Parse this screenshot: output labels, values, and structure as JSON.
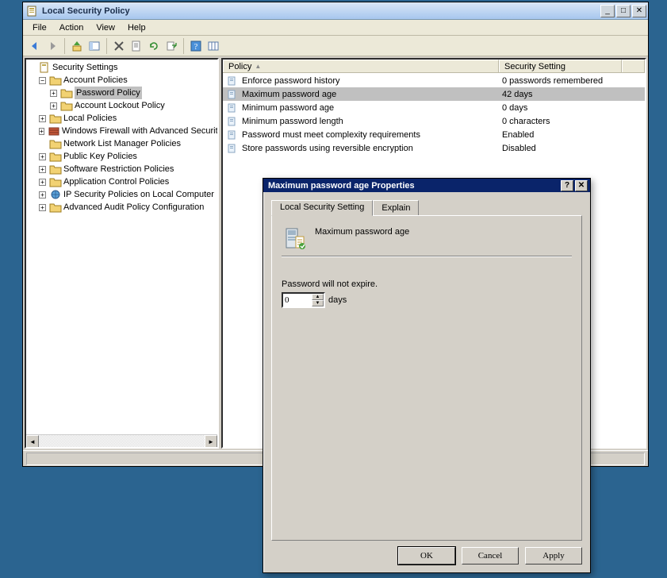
{
  "window": {
    "title": "Local Security Policy",
    "controls": {
      "minimize": "_",
      "maximize": "□",
      "close": "✕"
    }
  },
  "menu": {
    "items": [
      "File",
      "Action",
      "View",
      "Help"
    ]
  },
  "toolbar": {
    "icons": [
      "back",
      "forward",
      "up",
      "detail",
      "delete",
      "refresh",
      "export",
      "help",
      "columns"
    ]
  },
  "tree": {
    "root": "Security Settings",
    "account_policies": "Account Policies",
    "password_policy": "Password Policy",
    "account_lockout_policy": "Account Lockout Policy",
    "local_policies": "Local Policies",
    "windows_firewall": "Windows Firewall with Advanced Security",
    "network_list": "Network List Manager Policies",
    "public_key": "Public Key Policies",
    "software_restriction": "Software Restriction Policies",
    "app_control": "Application Control Policies",
    "ip_security": "IP Security Policies on Local Computer",
    "advanced_audit": "Advanced Audit Policy Configuration"
  },
  "list": {
    "columns": {
      "policy": "Policy",
      "setting": "Security Setting"
    },
    "sort_indicator": "▲",
    "rows": [
      {
        "name": "Enforce password history",
        "value": "0 passwords remembered"
      },
      {
        "name": "Maximum password age",
        "value": "42 days",
        "selected": true
      },
      {
        "name": "Minimum password age",
        "value": "0 days"
      },
      {
        "name": "Minimum password length",
        "value": "0 characters"
      },
      {
        "name": "Password must meet complexity requirements",
        "value": "Enabled"
      },
      {
        "name": "Store passwords using reversible encryption",
        "value": "Disabled"
      }
    ]
  },
  "dialog": {
    "title": "Maximum password age Properties",
    "help": "?",
    "close": "✕",
    "tabs": {
      "local": "Local Security Setting",
      "explain": "Explain"
    },
    "policy_name": "Maximum password age",
    "field_label": "Password will not expire.",
    "value": "0",
    "unit": "days",
    "buttons": {
      "ok": "OK",
      "cancel": "Cancel",
      "apply": "Apply"
    }
  }
}
